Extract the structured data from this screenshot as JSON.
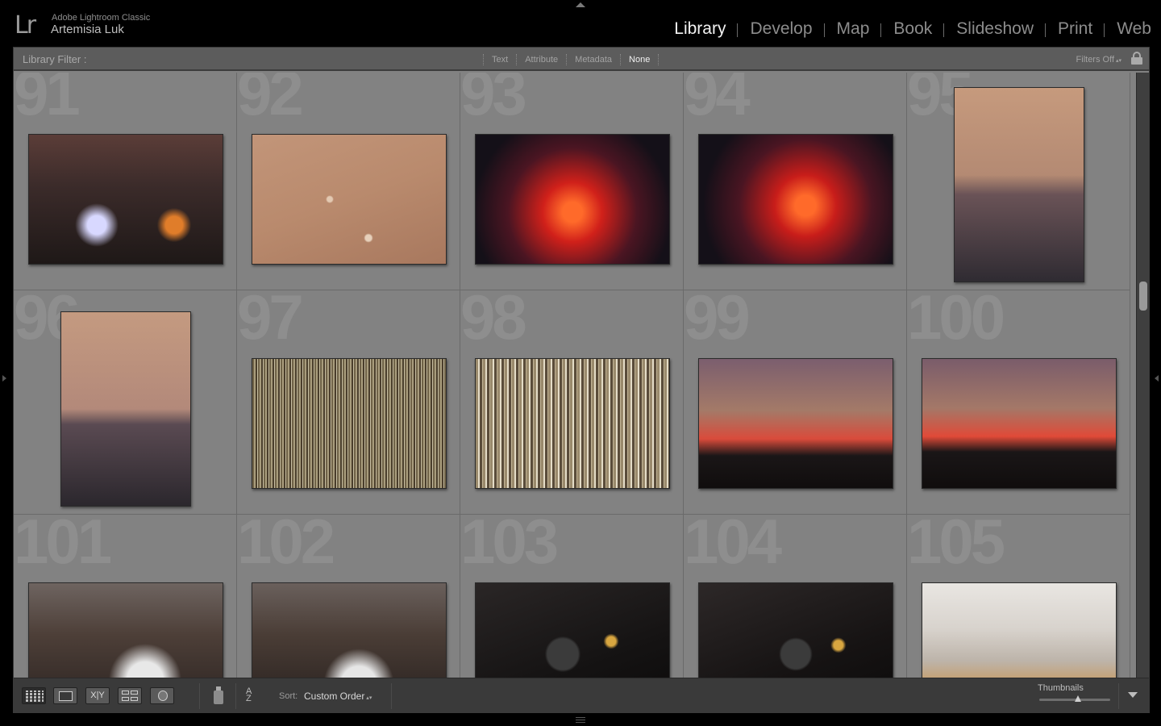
{
  "app": {
    "logo": "Lr",
    "name": "Adobe Lightroom Classic",
    "user": "Artemisia Luk"
  },
  "modules": [
    "Library",
    "Develop",
    "Map",
    "Book",
    "Slideshow",
    "Print",
    "Web"
  ],
  "active_module": "Library",
  "filter_bar": {
    "label": "Library Filter :",
    "tabs": [
      "Text",
      "Attribute",
      "Metadata",
      "None"
    ],
    "active_tab": "None",
    "filters_status": "Filters Off"
  },
  "grid": {
    "cells": [
      {
        "number": "91",
        "orientation": "landscape",
        "photo": "p1"
      },
      {
        "number": "92",
        "orientation": "landscape",
        "photo": "p2"
      },
      {
        "number": "93",
        "orientation": "landscape",
        "photo": "p3"
      },
      {
        "number": "94",
        "orientation": "landscape",
        "photo": "p4"
      },
      {
        "number": "95",
        "orientation": "portrait",
        "photo": "p5"
      },
      {
        "number": "96",
        "orientation": "portrait",
        "photo": "p6"
      },
      {
        "number": "97",
        "orientation": "landscape",
        "photo": "p7"
      },
      {
        "number": "98",
        "orientation": "landscape",
        "photo": "p8"
      },
      {
        "number": "99",
        "orientation": "landscape",
        "photo": "p9"
      },
      {
        "number": "100",
        "orientation": "landscape",
        "photo": "p10"
      },
      {
        "number": "101",
        "orientation": "landscape",
        "photo": "p11"
      },
      {
        "number": "102",
        "orientation": "landscape",
        "photo": "p12"
      },
      {
        "number": "103",
        "orientation": "landscape",
        "photo": "p13"
      },
      {
        "number": "104",
        "orientation": "landscape",
        "photo": "p14"
      },
      {
        "number": "105",
        "orientation": "landscape",
        "photo": "p15"
      }
    ]
  },
  "toolbar": {
    "compare_label": "X|Y",
    "sort_label": "Sort:",
    "sort_value": "Custom Order",
    "thumbnails_label": "Thumbnails",
    "thumbnail_size_fraction": 0.55
  },
  "colors": {
    "grid_background": "#828282",
    "active_module_text": "#f2f2f2",
    "inactive_module_text": "#8c8c8c"
  }
}
